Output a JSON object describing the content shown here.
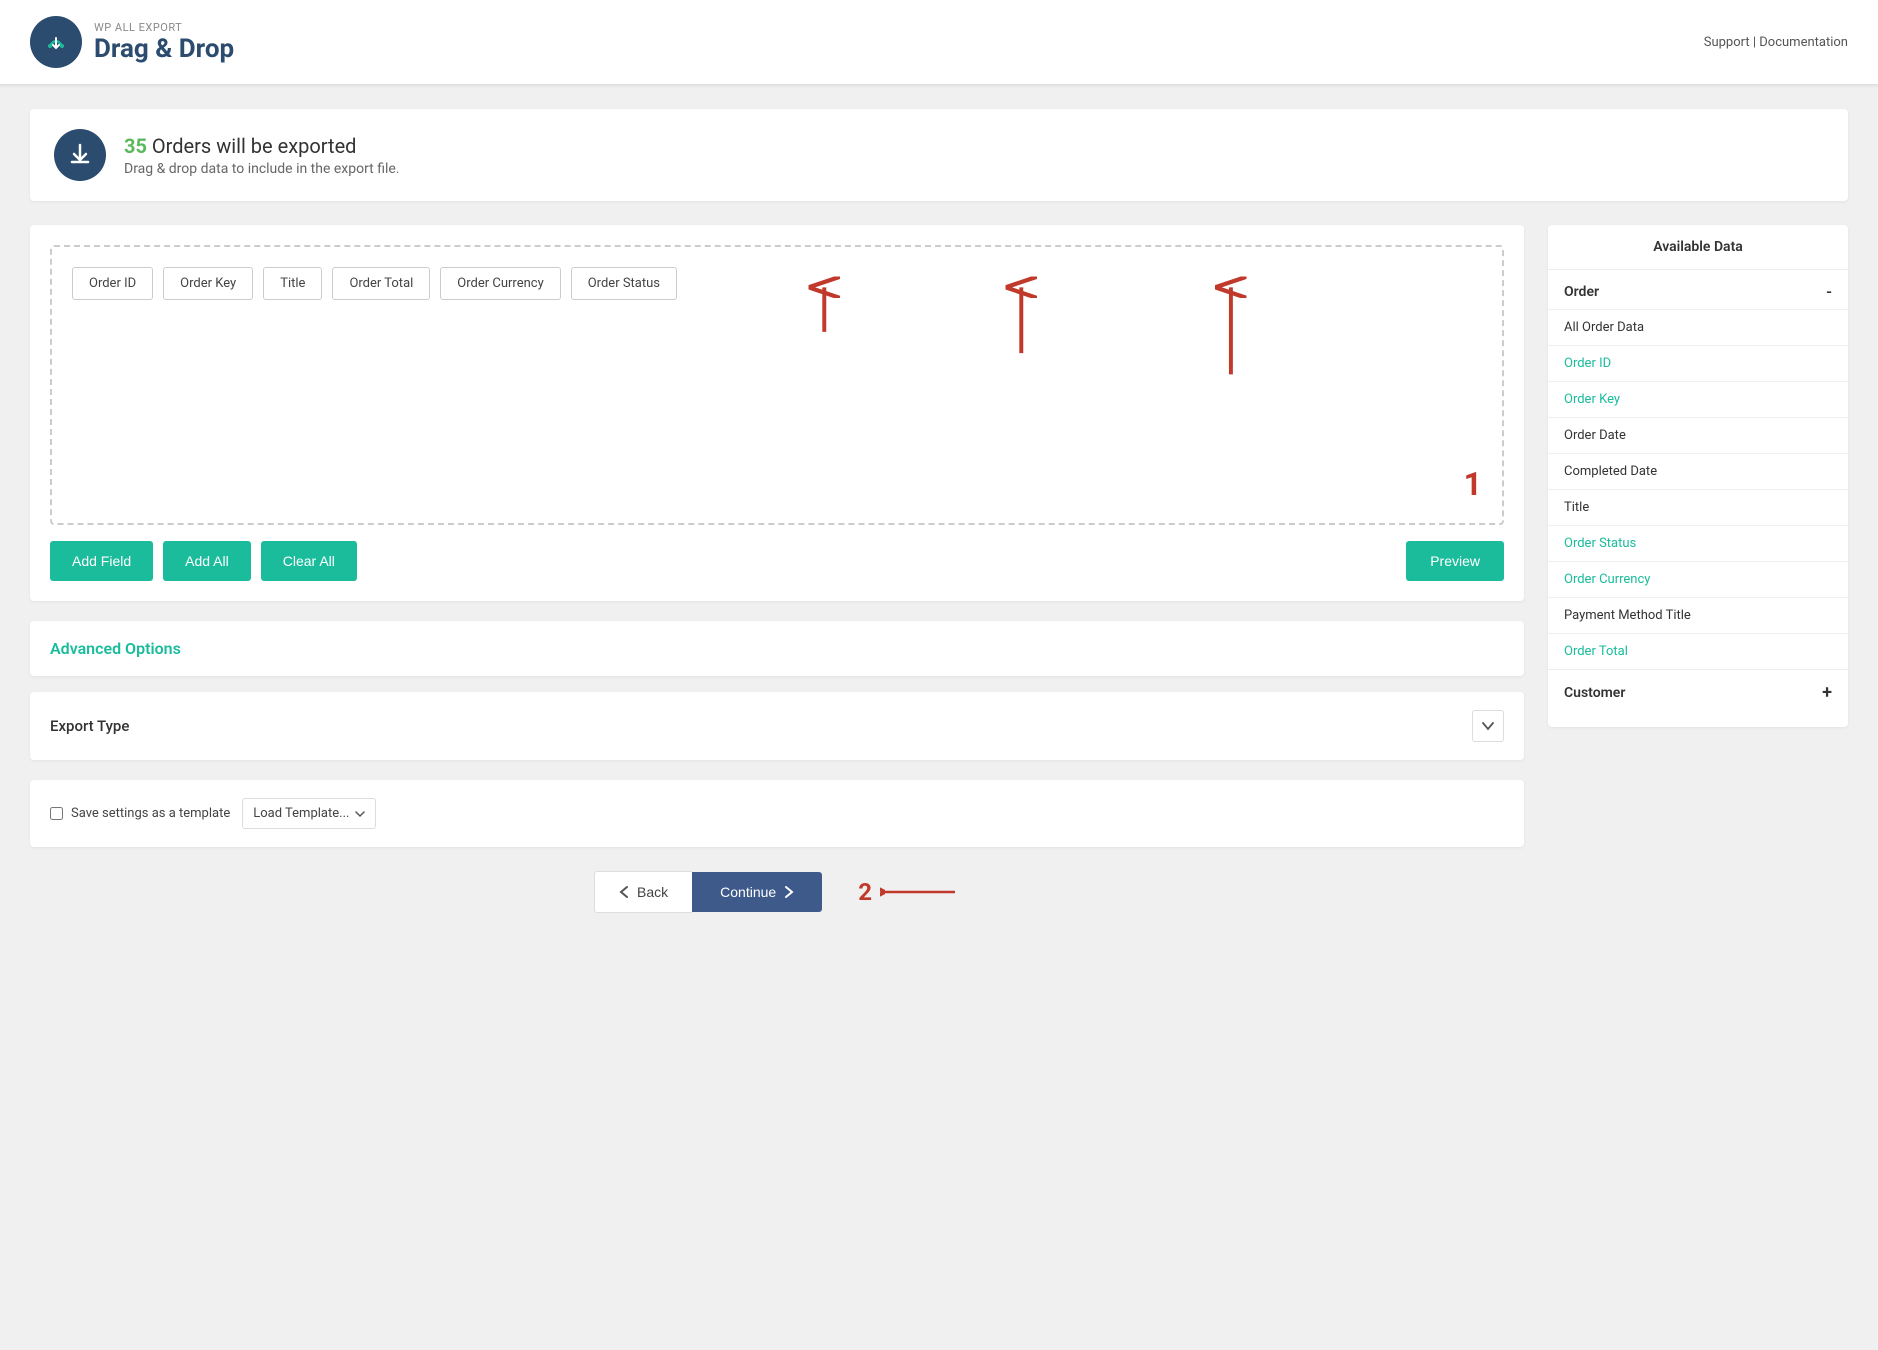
{
  "header": {
    "brand_top": "WP ALL EXPORT",
    "brand_main": "Drag & Drop",
    "support_link": "Support",
    "divider": "|",
    "docs_link": "Documentation"
  },
  "banner": {
    "count": "35",
    "text": "Orders will be exported",
    "subtext": "Drag & drop data to include in the export file."
  },
  "drag_drop": {
    "fields": [
      "Order ID",
      "Order Key",
      "Title",
      "Order Total",
      "Order Currency",
      "Order Status"
    ]
  },
  "buttons": {
    "add_field": "Add Field",
    "add_all": "Add All",
    "clear_all": "Clear All",
    "preview": "Preview"
  },
  "advanced_options": {
    "title": "Advanced Options"
  },
  "export_type": {
    "label": "Export Type"
  },
  "bottom_bar": {
    "save_label": "Save settings as a template",
    "load_template": "Load Template..."
  },
  "nav": {
    "back": "Back",
    "continue": "Continue"
  },
  "available_data": {
    "title": "Available Data",
    "order_section": "Order",
    "order_toggle": "-",
    "order_items": [
      {
        "label": "All Order Data",
        "teal": false
      },
      {
        "label": "Order ID",
        "teal": true
      },
      {
        "label": "Order Key",
        "teal": true
      },
      {
        "label": "Order Date",
        "teal": false
      },
      {
        "label": "Completed Date",
        "teal": false
      },
      {
        "label": "Title",
        "teal": false
      },
      {
        "label": "Order Status",
        "teal": true
      },
      {
        "label": "Order Currency",
        "teal": true
      },
      {
        "label": "Payment Method Title",
        "teal": false
      },
      {
        "label": "Order Total",
        "teal": true
      }
    ],
    "customer_section": "Customer",
    "customer_toggle": "+"
  },
  "annotation_1": "1",
  "annotation_2": "2"
}
